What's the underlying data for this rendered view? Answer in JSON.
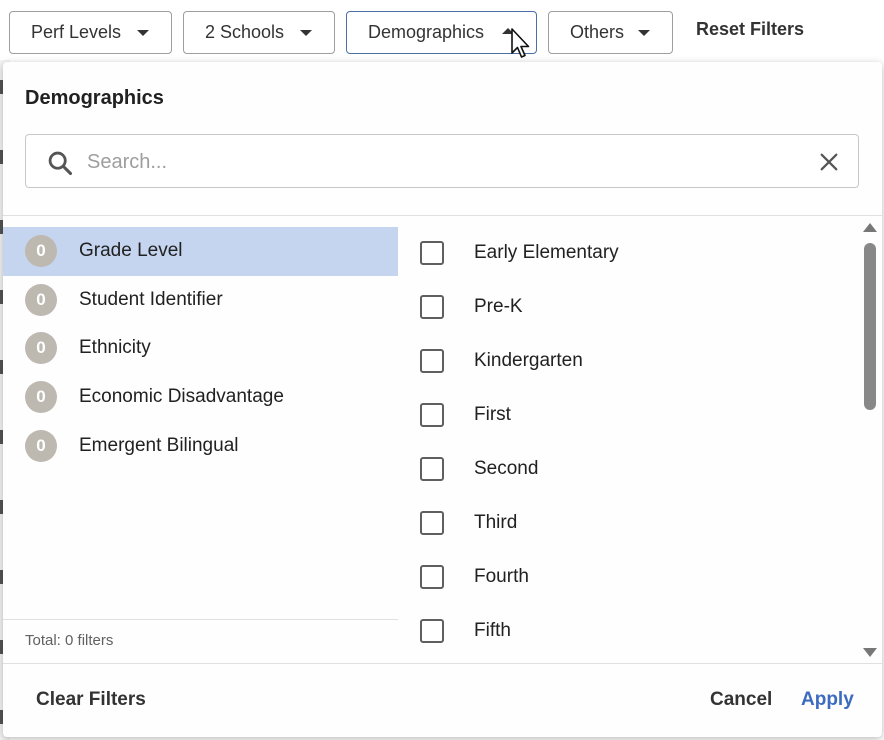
{
  "filter_bar": {
    "buttons": [
      {
        "label": "Perf Levels"
      },
      {
        "label": "2 Schools"
      },
      {
        "label": "Demographics"
      },
      {
        "label": "Others"
      }
    ],
    "reset_label": "Reset Filters"
  },
  "panel": {
    "title": "Demographics",
    "search": {
      "placeholder": "Search...",
      "value": ""
    },
    "categories": [
      {
        "count": "0",
        "label": "Grade Level",
        "selected": true
      },
      {
        "count": "0",
        "label": "Student Identifier"
      },
      {
        "count": "0",
        "label": "Ethnicity"
      },
      {
        "count": "0",
        "label": "Economic Disadvantage"
      },
      {
        "count": "0",
        "label": "Emergent Bilingual"
      }
    ],
    "total": "Total: 0 filters",
    "options": [
      {
        "label": "Early Elementary",
        "checked": false
      },
      {
        "label": "Pre-K",
        "checked": false
      },
      {
        "label": "Kindergarten",
        "checked": false
      },
      {
        "label": "First",
        "checked": false
      },
      {
        "label": "Second",
        "checked": false
      },
      {
        "label": "Third",
        "checked": false
      },
      {
        "label": "Fourth",
        "checked": false
      },
      {
        "label": "Fifth",
        "checked": false
      }
    ],
    "footer": {
      "clear_label": "Clear Filters",
      "cancel_label": "Cancel",
      "apply_label": "Apply"
    }
  },
  "colors": {
    "selected_row": "#c5d5ef",
    "apply_accent": "#3c6bbf",
    "badge": "#bdb9b1"
  }
}
